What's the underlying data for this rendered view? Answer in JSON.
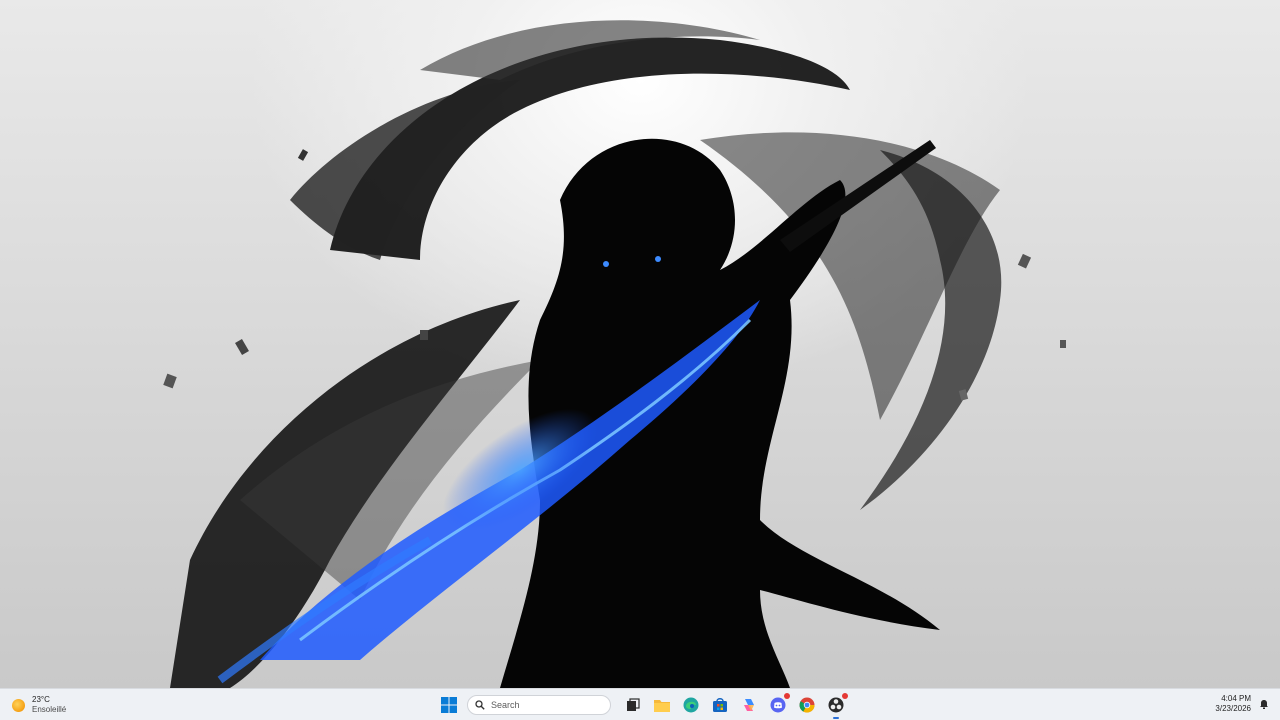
{
  "weather": {
    "temperature": "23°C",
    "condition": "Ensoleillé",
    "icon": "sun-icon"
  },
  "taskbar": {
    "search_placeholder": "Search",
    "pinned": [
      {
        "name": "start",
        "icon": "windows-logo-icon"
      },
      {
        "name": "task-view",
        "icon": "task-view-icon"
      },
      {
        "name": "file-explorer",
        "icon": "folder-icon"
      },
      {
        "name": "edge",
        "icon": "edge-icon"
      },
      {
        "name": "microsoft-store",
        "icon": "store-icon"
      },
      {
        "name": "copilot",
        "icon": "copilot-icon"
      },
      {
        "name": "discord",
        "icon": "discord-icon"
      },
      {
        "name": "chrome",
        "icon": "chrome-icon"
      },
      {
        "name": "obs",
        "icon": "obs-icon"
      }
    ]
  },
  "clock": {
    "time": "4:04 PM",
    "date": "3/23/2026"
  },
  "colors": {
    "taskbar_bg": "#eef1f5",
    "accent": "#2b6fd6",
    "wallpaper_blue": "#1f5bff"
  }
}
